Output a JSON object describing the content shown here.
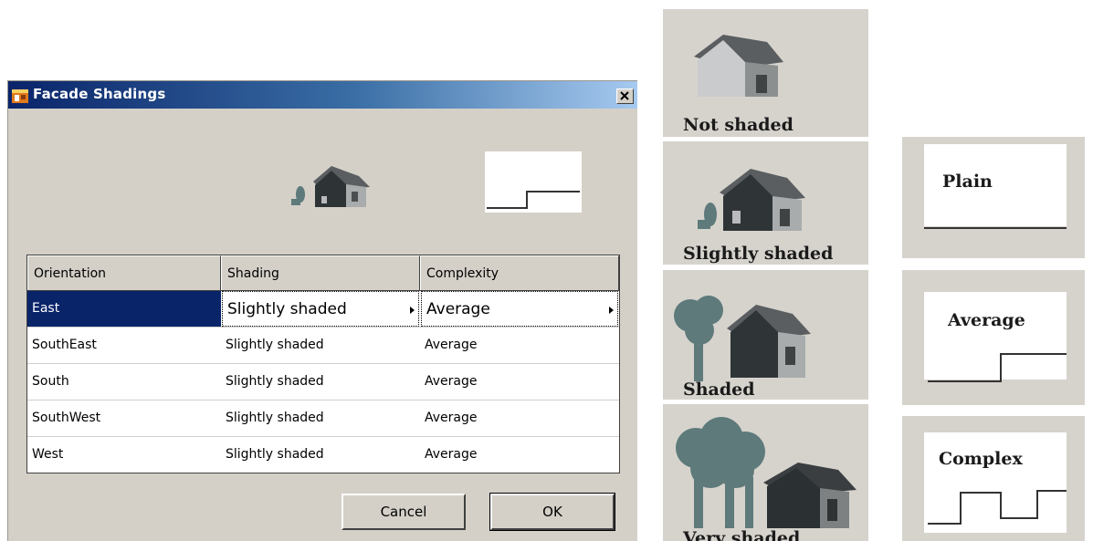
{
  "dialog": {
    "title": "Facade Shadings",
    "close_label": "X",
    "table": {
      "headers": [
        "Orientation",
        "Shading",
        "Complexity"
      ],
      "rows": [
        {
          "orientation": "East",
          "shading": "Slightly shaded",
          "complexity": "Average",
          "selected": true
        },
        {
          "orientation": "SouthEast",
          "shading": "Slightly shaded",
          "complexity": "Average"
        },
        {
          "orientation": "South",
          "shading": "Slightly shaded",
          "complexity": "Average"
        },
        {
          "orientation": "SouthWest",
          "shading": "Slightly shaded",
          "complexity": "Average"
        },
        {
          "orientation": "West",
          "shading": "Slightly shaded",
          "complexity": "Average"
        }
      ]
    },
    "buttons": {
      "cancel": "Cancel",
      "ok": "OK"
    }
  },
  "shading_legend": [
    "Not shaded",
    "Slightly shaded",
    "Shaded",
    "Very shaded"
  ],
  "complexity_legend": [
    "Plain",
    "Average",
    "Complex"
  ],
  "colors": {
    "title_bar_start": "#0a246a",
    "title_bar_end": "#a6caf0",
    "dialog_bg": "#d4d0c8",
    "selection_bg": "#0a246a",
    "tree": "#5e7a7a",
    "roof": "#555a5c"
  }
}
